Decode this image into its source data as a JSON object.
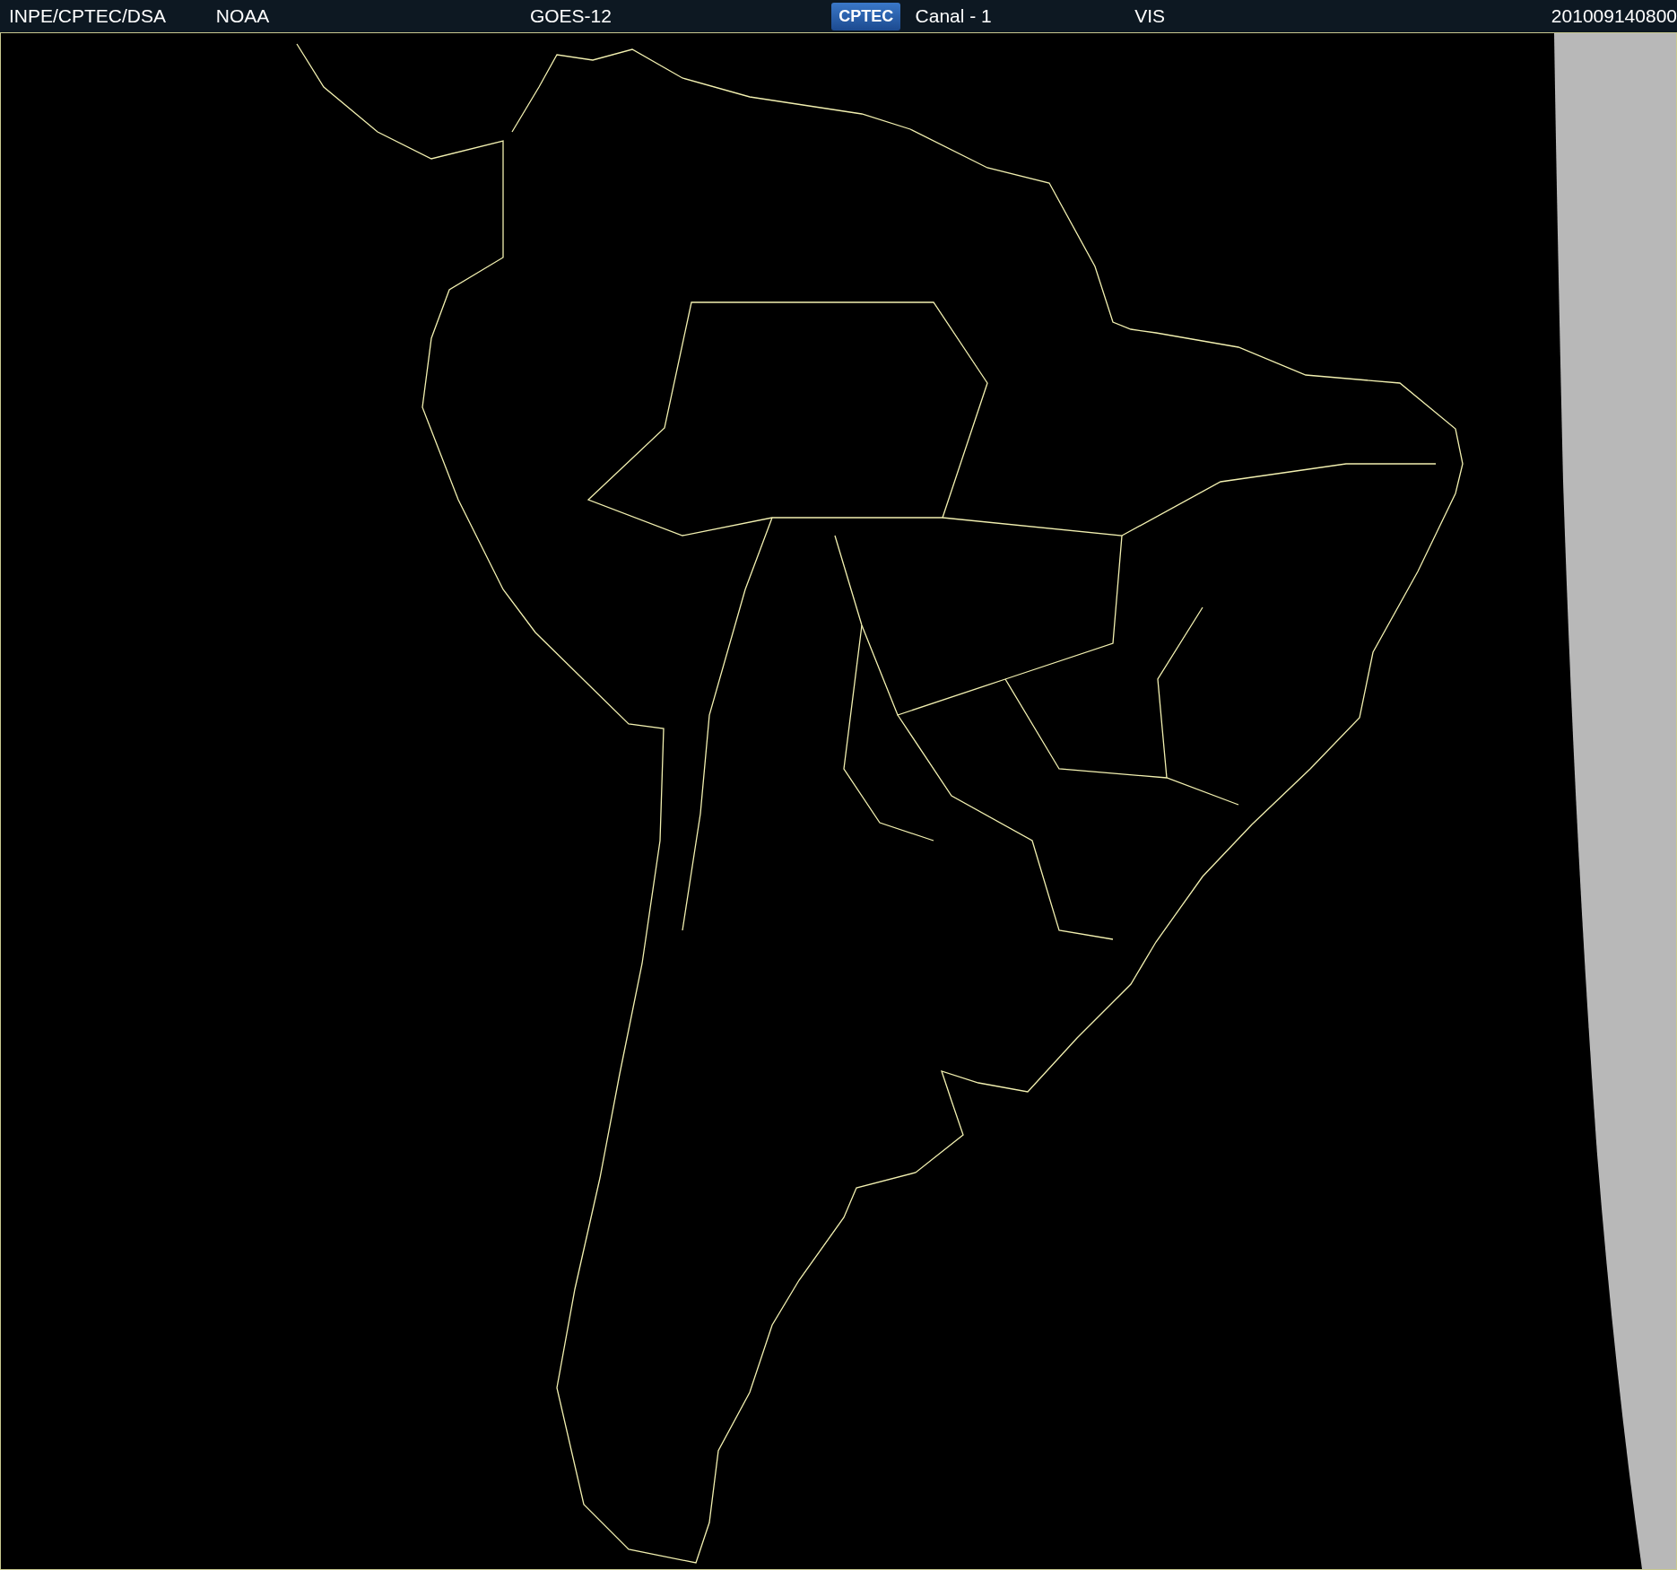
{
  "header": {
    "items": [
      {
        "kind": "text",
        "text": "INPE/CPTEC/DSA"
      },
      {
        "kind": "text",
        "text": "NOAA"
      },
      {
        "kind": "text",
        "text": "GOES-12"
      },
      {
        "kind": "logo",
        "text": "CPTEC"
      },
      {
        "kind": "text",
        "text": "Canal - 1"
      },
      {
        "kind": "text",
        "text": "VIS"
      },
      {
        "kind": "text",
        "text": "201009140800"
      }
    ]
  }
}
